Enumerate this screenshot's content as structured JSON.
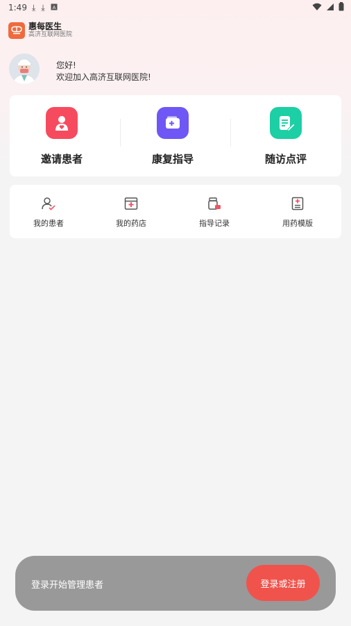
{
  "status_bar": {
    "time": "1:49"
  },
  "brand": {
    "name": "惠每医生",
    "subtitle": "高济互联网医院"
  },
  "greeting": {
    "line1": "您好!",
    "line2": "欢迎加入高济互联网医院!"
  },
  "actions": [
    {
      "label": "邀请患者",
      "icon": "invite-patient-icon",
      "color": "#f64b5e"
    },
    {
      "label": "康复指导",
      "icon": "rehab-guide-icon",
      "color": "#6f57f5"
    },
    {
      "label": "随访点评",
      "icon": "followup-review-icon",
      "color": "#1ccfa4"
    }
  ],
  "menu": [
    {
      "label": "我的患者",
      "icon": "my-patients-icon"
    },
    {
      "label": "我的药店",
      "icon": "my-pharmacy-icon"
    },
    {
      "label": "指导记录",
      "icon": "guide-records-icon"
    },
    {
      "label": "用药模版",
      "icon": "medication-template-icon"
    }
  ],
  "login_bar": {
    "text": "登录开始管理患者",
    "button": "登录或注册",
    "button_color": "#f0534c"
  }
}
